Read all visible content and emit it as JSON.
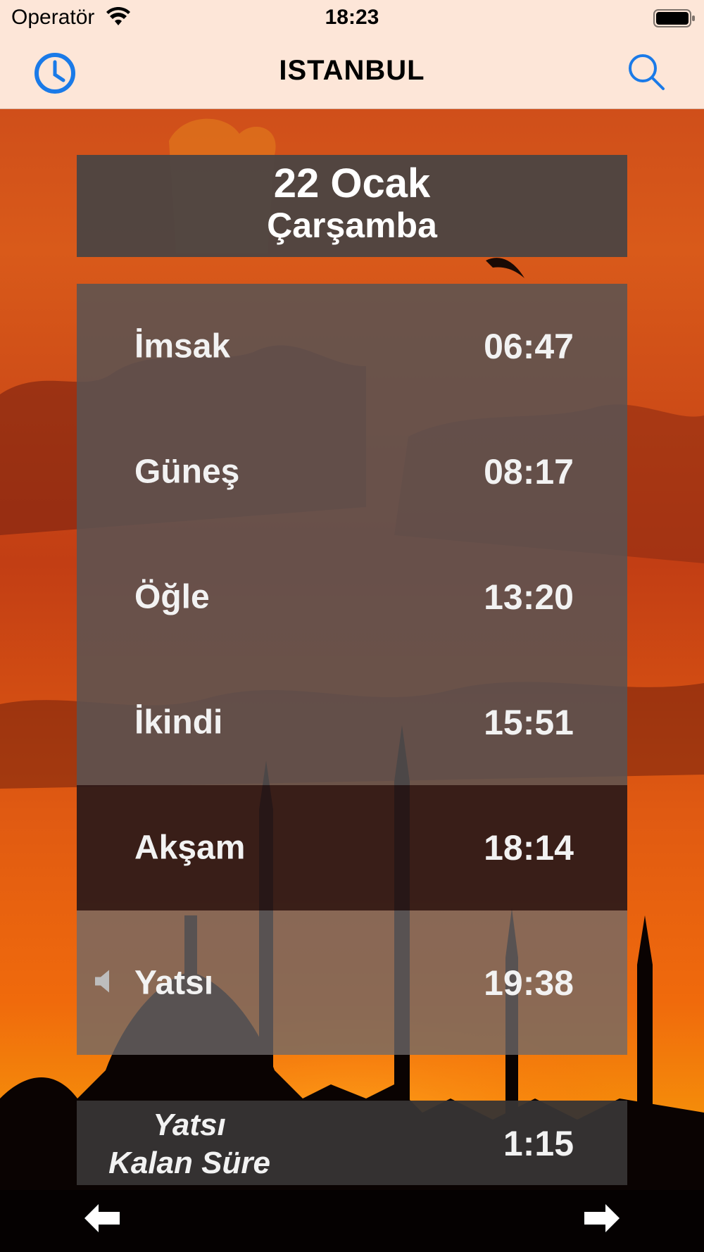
{
  "status_bar": {
    "carrier": "Operatör",
    "time": "18:23"
  },
  "nav": {
    "title": "ISTANBUL",
    "left_icon": "clock-icon",
    "right_icon": "search-icon",
    "accent": "#1a7ae8"
  },
  "date": {
    "day": "22 Ocak",
    "weekday": "Çarşamba"
  },
  "times": [
    {
      "name": "İmsak",
      "time": "06:47"
    },
    {
      "name": "Güneş",
      "time": "08:17"
    },
    {
      "name": "Öğle",
      "time": "13:20"
    },
    {
      "name": "İkindi",
      "time": "15:51"
    },
    {
      "name": "Akşam",
      "time": "18:14"
    },
    {
      "name": "Yatsı",
      "time": "19:38"
    }
  ],
  "remaining": {
    "label_line1": "Yatsı",
    "label_line2": "Kalan Süre",
    "value": "1:15"
  }
}
